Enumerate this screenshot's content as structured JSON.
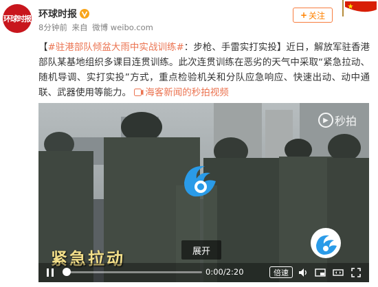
{
  "account": {
    "avatar_text": "环球时报",
    "name": "环球时报",
    "verified_icon": "verified-v-icon",
    "time_ago": "8分钟前",
    "source_prefix": "来自",
    "source": "微博 weibo.com",
    "follow_label": "关注",
    "follow_icon": "+"
  },
  "post": {
    "hashtag": "#驻港部队倾盆大雨中实战训练#",
    "body": "：步枪、手雷实打实投】近日，解放军驻香港部队某基地组织多课目连贯训练。此次连贯训练在恶劣的天气中采取“紧急拉动、随机导调、实打实投”方式，重点检验机关和分队应急响应、快速出动、动中通联、武器使用等能力。",
    "open_bracket": "【",
    "video_link": "海客新闻的秒拍视频"
  },
  "video": {
    "watermark": "秒拍",
    "caption": "紧急拉动",
    "expand_label": "展开",
    "time": "0:00/2:20",
    "speed_label": "倍速",
    "progress": 0.0
  },
  "colors": {
    "accent": "#ff8200",
    "link": "#eb7350",
    "avatar": "#c8161d",
    "verified": "#ffa500"
  }
}
